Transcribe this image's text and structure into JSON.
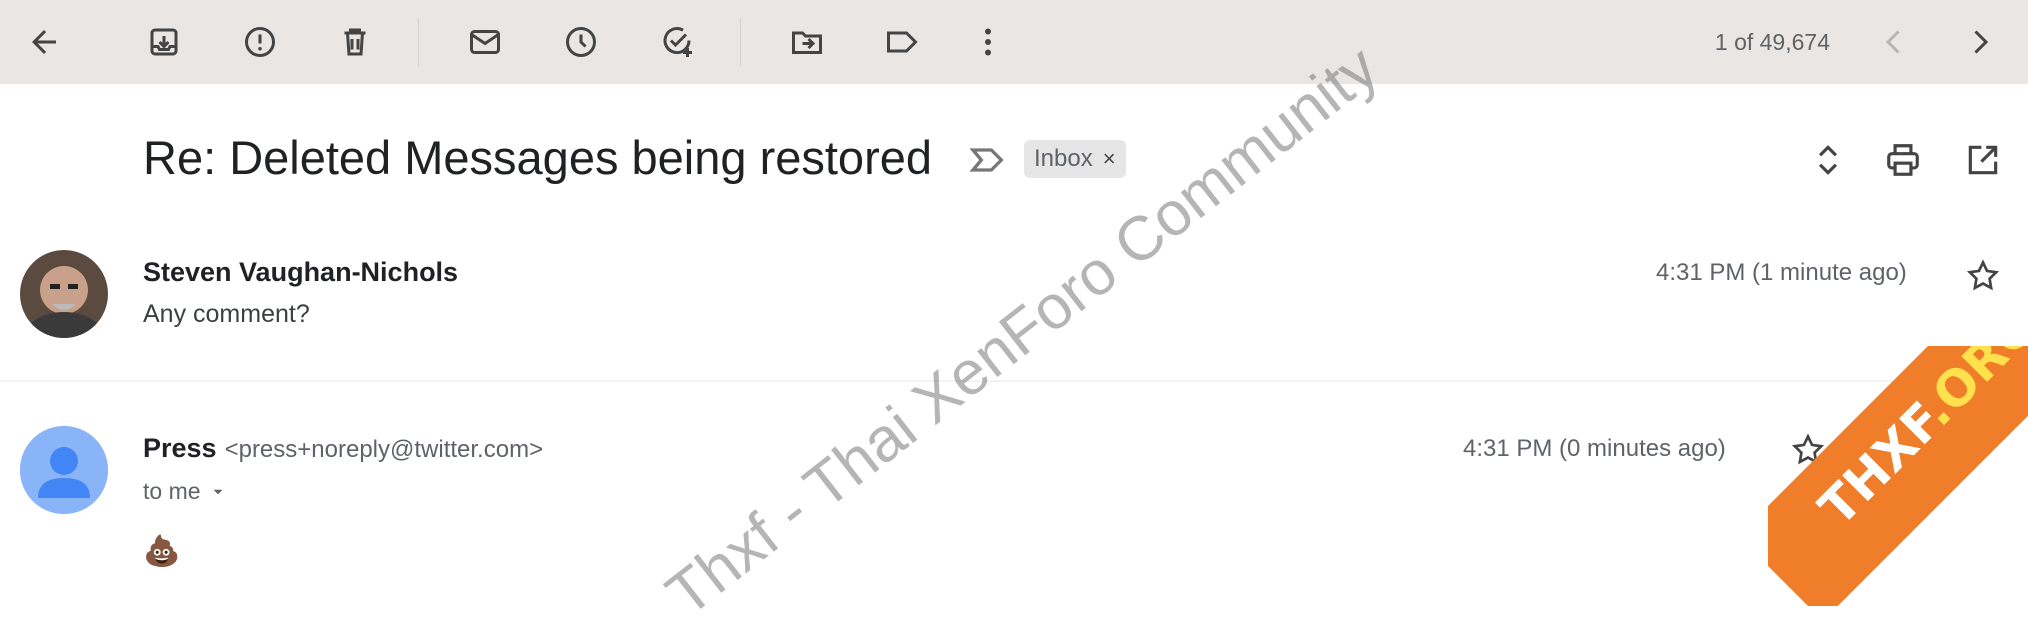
{
  "toolbar": {
    "icons": [
      "back-arrow-icon",
      "archive-icon",
      "report-spam-icon",
      "delete-icon",
      "mark-unread-icon",
      "snooze-icon",
      "add-task-icon",
      "move-to-icon",
      "label-icon",
      "more-vert-icon"
    ],
    "pagination": "1 of 49,674"
  },
  "subject": {
    "title": "Re: Deleted Messages being restored",
    "chip_label": "Inbox",
    "chip_close": "×"
  },
  "messages": [
    {
      "sender": "Steven Vaughan-Nichols",
      "snippet": "Any comment?",
      "time": "4:31 PM (1 minute ago)"
    },
    {
      "sender": "Press",
      "email": "<press+noreply@twitter.com>",
      "recipient": "to me",
      "time": "4:31 PM (0 minutes ago)",
      "body_emoji": "💩"
    }
  ],
  "watermark": "Thxf - Thai XenForo Community",
  "badge": {
    "name": "THXF",
    "tld": ".ORG"
  },
  "colors": {
    "toolbar_bg": "#e9e6e4",
    "avatar_blue": "#8ab4f8",
    "badge_orange": "#ef7d2a"
  }
}
